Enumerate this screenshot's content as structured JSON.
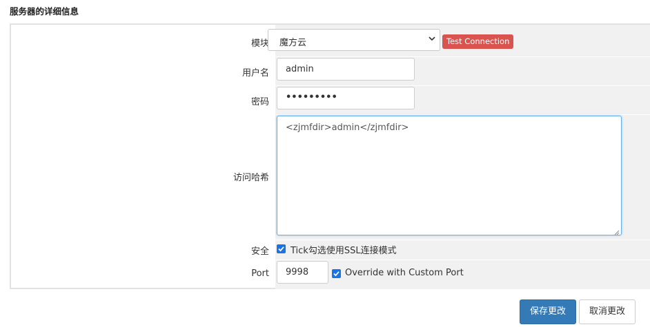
{
  "section_title": "服务器的详细信息",
  "form": {
    "module": {
      "label": "模块",
      "selected": "魔方云",
      "test_button": "Test Connection"
    },
    "username": {
      "label": "用户名",
      "value": "admin"
    },
    "password": {
      "label": "密码",
      "value": "•••••••••"
    },
    "access_hash": {
      "label": "访问哈希",
      "value": "<zjmfdir>admin</zjmfdir>"
    },
    "security": {
      "label": "安全",
      "checkbox_label": "Tick勾选使用SSL连接模式",
      "checked": true
    },
    "port": {
      "label": "Port",
      "value": "9998",
      "checkbox_label": "Override with Custom Port",
      "checked": true
    }
  },
  "actions": {
    "save": "保存更改",
    "cancel": "取消更改"
  },
  "colors": {
    "danger": "#d9534f",
    "primary": "#337ab7",
    "checkbox": "#1a73e8"
  }
}
